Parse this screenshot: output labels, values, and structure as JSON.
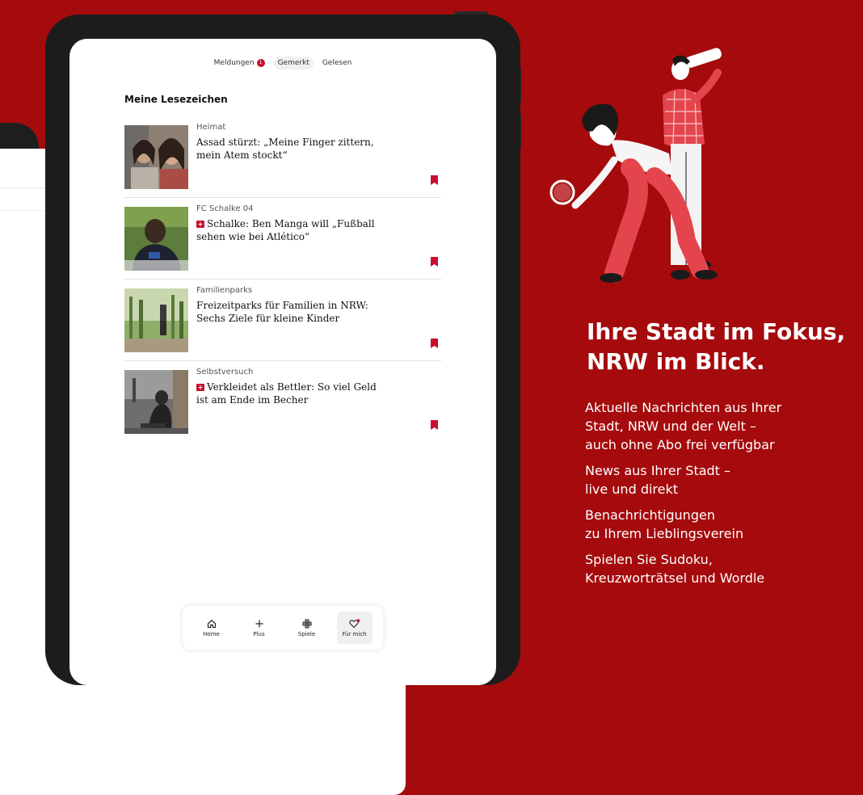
{
  "tabs": [
    {
      "label": "Meldungen",
      "badge": "1"
    },
    {
      "label": "Gemerkt"
    },
    {
      "label": "Gelesen"
    }
  ],
  "section_title": "Meine Lesezeichen",
  "articles": [
    {
      "kicker": "Heimat",
      "headline": "Assad stürzt: „Meine Finger zittern, mein Atem stockt“",
      "plus": false
    },
    {
      "kicker": "FC Schalke 04",
      "headline": "Schalke: Ben Manga will „Fußball sehen wie bei Atlético“",
      "plus": true
    },
    {
      "kicker": "Familienparks",
      "headline": "Freizeitparks für Familien in NRW: Sechs Ziele für kleine Kinder",
      "plus": false
    },
    {
      "kicker": "Selbstversuch",
      "headline": "Verkleidet als Bettler: So viel Geld ist am Ende im Becher",
      "plus": true
    }
  ],
  "nav": [
    {
      "label": "Home",
      "icon": "home-icon"
    },
    {
      "label": "Plus",
      "icon": "plus-icon"
    },
    {
      "label": "Spiele",
      "icon": "puzzle-grid-icon"
    },
    {
      "label": "Für mich",
      "icon": "heart-icon"
    }
  ],
  "promo": {
    "title": "Ihre Stadt im Fokus, NRW im Blick.",
    "features": [
      "Aktuelle Nachrichten aus Ihrer\nStadt, NRW und der Welt –\nauch ohne Abo frei verfügbar",
      "News aus Ihrer Stadt –\nlive und direkt",
      "Benachrichtigungen\nzu Ihrem Lieblingsverein",
      "Spielen Sie Sudoku,\nKreuzworträtsel und Wordle"
    ]
  },
  "colors": {
    "background": "#a50a0c",
    "accent": "#c8102e"
  }
}
